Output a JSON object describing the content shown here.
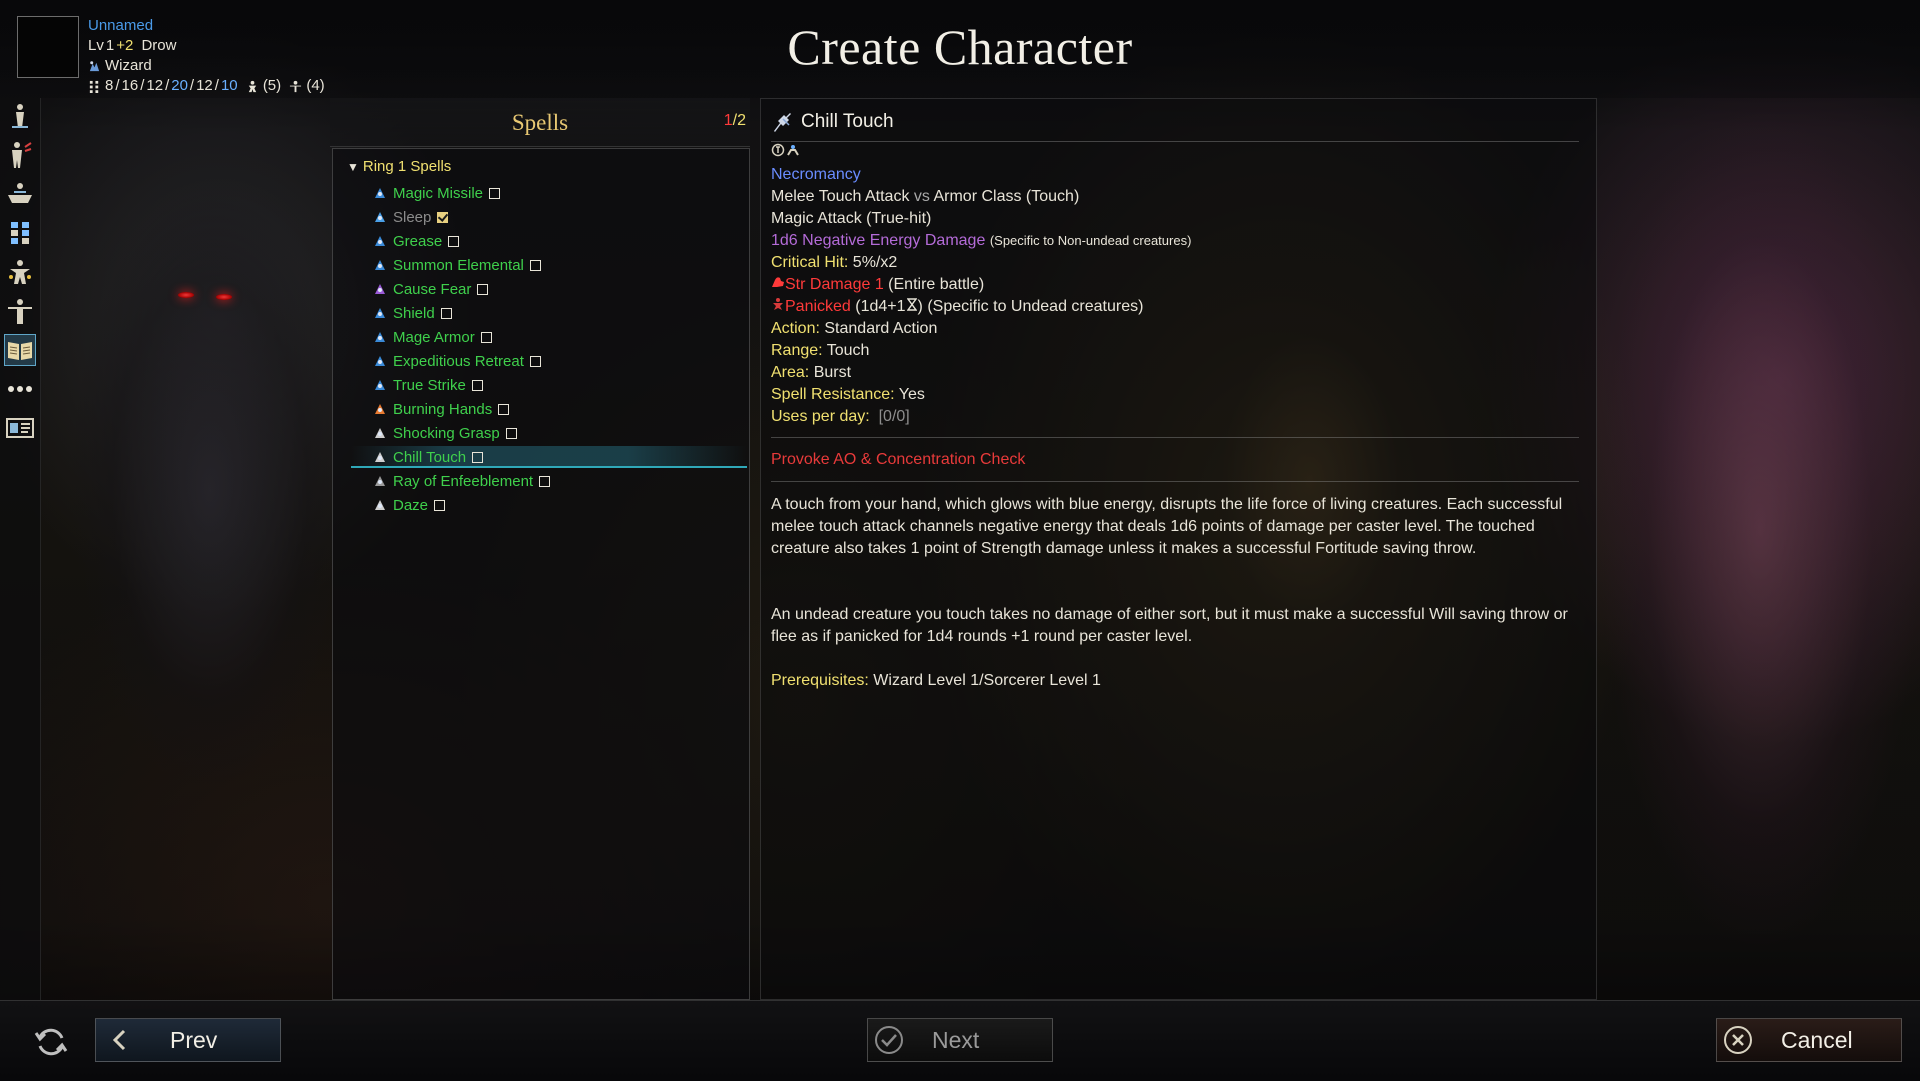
{
  "header": {
    "title": "Create Character",
    "character": {
      "name": "Unnamed",
      "level_prefix": "Lv",
      "level_base": "1",
      "level_bonus": "+2",
      "race": "Drow",
      "class": "Wizard",
      "stats": [
        {
          "value": "8",
          "color": "#e8e4d8"
        },
        {
          "value": "16",
          "color": "#e8e4d8"
        },
        {
          "value": "12",
          "color": "#e8e4d8"
        },
        {
          "value": "20",
          "color": "#6ab0ff"
        },
        {
          "value": "12",
          "color": "#e8e4d8"
        },
        {
          "value": "10",
          "color": "#6ab0ff"
        }
      ],
      "skill_points": "(5)",
      "feat_points": "(4)"
    }
  },
  "sidebar": {
    "items": [
      {
        "name": "race-tab",
        "icon": "person-icon"
      },
      {
        "name": "class-tab",
        "icon": "class-figure-icon"
      },
      {
        "name": "alignment-tab",
        "icon": "scales-icon"
      },
      {
        "name": "abilities-tab",
        "icon": "grid-icon"
      },
      {
        "name": "skills-tab",
        "icon": "skill-figure-icon"
      },
      {
        "name": "feats-tab",
        "icon": "feat-figure-icon"
      },
      {
        "name": "spells-tab",
        "icon": "spellbook-icon",
        "active": true
      },
      {
        "name": "more-tab",
        "icon": "ellipsis-icon"
      },
      {
        "name": "summary-tab",
        "icon": "id-card-icon"
      }
    ]
  },
  "spells": {
    "title": "Spells",
    "counter_current": "1",
    "counter_total": "/2",
    "group_label": "Ring 1 Spells",
    "items": [
      {
        "label": "Magic Missile",
        "checked": false,
        "dim": false,
        "icon": "magic-missile-icon",
        "color": "#3a8ad8"
      },
      {
        "label": "Sleep",
        "checked": true,
        "dim": true,
        "icon": "sleep-icon",
        "color": "#4aa0e8"
      },
      {
        "label": "Grease",
        "checked": false,
        "dim": false,
        "icon": "grease-icon",
        "color": "#3a8ad8"
      },
      {
        "label": "Summon Elemental",
        "checked": false,
        "dim": false,
        "icon": "summon-elemental-icon",
        "color": "#3a8ad8"
      },
      {
        "label": "Cause Fear",
        "checked": false,
        "dim": false,
        "icon": "cause-fear-icon",
        "color": "#9a5ad8"
      },
      {
        "label": "Shield",
        "checked": false,
        "dim": false,
        "icon": "shield-icon",
        "color": "#3a8ad8"
      },
      {
        "label": "Mage Armor",
        "checked": false,
        "dim": false,
        "icon": "mage-armor-icon",
        "color": "#3a8ad8"
      },
      {
        "label": "Expeditious Retreat",
        "checked": false,
        "dim": false,
        "icon": "expeditious-retreat-icon",
        "color": "#3a8ad8"
      },
      {
        "label": "True Strike",
        "checked": false,
        "dim": false,
        "icon": "true-strike-icon",
        "color": "#3a8ad8"
      },
      {
        "label": "Burning Hands",
        "checked": false,
        "dim": false,
        "icon": "burning-hands-icon",
        "color": "#e87a30"
      },
      {
        "label": "Shocking Grasp",
        "checked": false,
        "dim": false,
        "icon": "shocking-grasp-icon",
        "color": "#cfcfcf"
      },
      {
        "label": "Chill Touch",
        "checked": false,
        "dim": false,
        "selected": true,
        "icon": "chill-touch-icon",
        "color": "#cfcfcf"
      },
      {
        "label": "Ray of Enfeeblement",
        "checked": false,
        "dim": false,
        "icon": "ray-of-enfeeblement-icon",
        "color": "#9a9a9a"
      },
      {
        "label": "Daze",
        "checked": false,
        "dim": false,
        "icon": "daze-icon",
        "color": "#cfcfcf"
      }
    ]
  },
  "detail": {
    "title": "Chill Touch",
    "school": "Necromancy",
    "attack_line_a": "Melee Touch Attack",
    "attack_line_vs": " vs ",
    "attack_line_b": "Armor Class (Touch)",
    "magic_attack": "Magic Attack (True-hit)",
    "damage": "1d6 Negative Energy Damage",
    "damage_note": "(Specific to Non-undead creatures)",
    "critical_label": "Critical Hit:",
    "critical_value": "5%/x2",
    "str_damage": "Str Damage 1",
    "str_note": "(Entire battle)",
    "panicked": "Panicked",
    "panicked_duration": "(1d4+1",
    "panicked_duration_close": ")",
    "panicked_note": "(Specific to Undead creatures)",
    "action_label": "Action:",
    "action_value": "Standard Action",
    "range_label": "Range:",
    "range_value": "Touch",
    "area_label": "Area:",
    "area_value": "Burst",
    "sr_label": "Spell Resistance:",
    "sr_value": "Yes",
    "uses_label": "Uses per day:",
    "uses_value": "[0/0]",
    "provoke": "Provoke AO & Concentration Check",
    "description_1": "A touch from your hand, which glows with blue energy, disrupts the life force of living creatures. Each successful melee touch attack channels negative energy that deals 1d6 points of damage per caster level. The touched creature also takes 1 point of Strength damage unless it makes a successful Fortitude saving throw.",
    "description_2": "An undead creature you touch takes no damage of either sort, but it must make a successful Will saving throw or flee as if panicked for 1d4 rounds +1 round per caster level.",
    "prereq_label": "Prerequisites:",
    "prereq_value": "Wizard Level 1/Sorcerer Level 1"
  },
  "footer": {
    "prev_label": "Prev",
    "next_label": "Next",
    "cancel_label": "Cancel"
  }
}
